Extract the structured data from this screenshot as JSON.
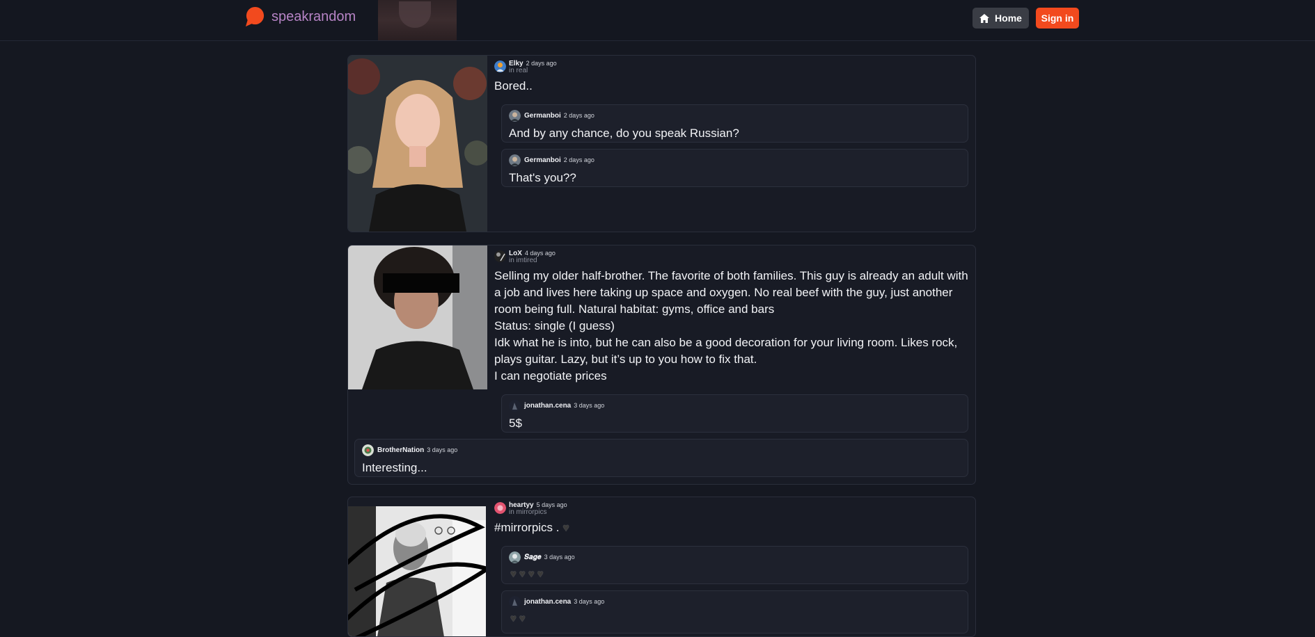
{
  "header": {
    "logo_text": "speakrandom",
    "home_label": "Home",
    "signin_label": "Sign in",
    "brand_color": "#f24a1e",
    "logo_text_color": "#b784c6"
  },
  "posts": [
    {
      "user": "Elky",
      "time": "2 days ago",
      "community": "in real",
      "text": "Bored..",
      "replies": [
        {
          "user": "Germanboi",
          "time": "2 days ago",
          "text": "And by any chance, do you speak Russian?"
        },
        {
          "user": "Germanboi",
          "time": "2 days ago",
          "text": "That's you??"
        }
      ]
    },
    {
      "user": "LoX",
      "time": "4 days ago",
      "community": "in imtired",
      "text": "Selling my older half-brother. The favorite of both families. This guy is already an adult with a job and lives here taking up space and oxygen. No real beef with the guy, just another room being full. Natural habitat: gyms, office and bars\nStatus: single (I guess)\nIdk what he is into, but he can also be a good decoration for your living room. Likes rock, plays guitar. Lazy, but it’s up to you how to fix that.\nI can negotiate prices",
      "replies": [
        {
          "user": "jonathan.cena",
          "time": "3 days ago",
          "text": "5$"
        },
        {
          "user": "BrotherNation",
          "time": "3 days ago",
          "text": "Interesting..."
        }
      ]
    },
    {
      "user": "heartyy",
      "time": "5 days ago",
      "community": "in mirrorpics",
      "text": "#mirrorpics .",
      "text_icon": "black-heart-icon",
      "replies": [
        {
          "user": "𝑺𝒂𝒈𝒆",
          "time": "3 days ago",
          "hearts": 4
        },
        {
          "user": "jonathan.cena",
          "time": "3 days ago",
          "hearts": 2
        }
      ]
    }
  ]
}
